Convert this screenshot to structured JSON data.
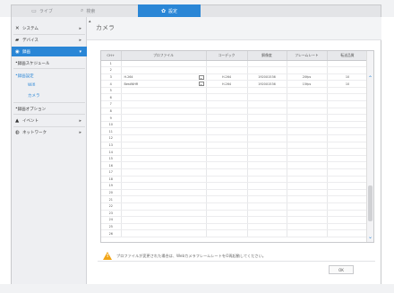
{
  "tabs": [
    {
      "label": "ライブ",
      "icon": "monitor-icon"
    },
    {
      "label": "検索",
      "icon": "search-icon"
    },
    {
      "label": "設定",
      "icon": "gear-icon"
    }
  ],
  "sidebar": {
    "items": [
      {
        "label": "システム",
        "icon": "tools-icon"
      },
      {
        "label": "デバイス",
        "icon": "camera-icon"
      },
      {
        "label": "録画",
        "icon": "record-icon"
      },
      {
        "label": "録画スケジュール"
      },
      {
        "label": "録画設定"
      },
      {
        "label": "Wifi"
      },
      {
        "label": "カメラ"
      },
      {
        "label": "録画オプション"
      },
      {
        "label": "イベント",
        "icon": "event-icon"
      },
      {
        "label": "ネットワーク",
        "icon": "network-icon"
      }
    ]
  },
  "main": {
    "title": "カメラ",
    "table": {
      "headers": [
        "CH+",
        "プロファイル",
        "コーデック",
        "解像度",
        "フレームレート",
        "転送品質"
      ],
      "rows": [
        {
          "ch": "1",
          "profile": "",
          "codec": "",
          "res": "",
          "fps": "",
          "q": ""
        },
        {
          "ch": "2",
          "profile": "",
          "codec": "",
          "res": "",
          "fps": "",
          "q": ""
        },
        {
          "ch": "3",
          "profile": "H.264",
          "codec": "H.264",
          "res": "1920X1536",
          "fps": "20fps",
          "q": "10"
        },
        {
          "ch": "4",
          "profile": "BestWHR",
          "codec": "H.264",
          "res": "1920X1536",
          "fps": "15fps",
          "q": "10"
        },
        {
          "ch": "5",
          "profile": "",
          "codec": "",
          "res": "",
          "fps": "",
          "q": ""
        },
        {
          "ch": "6",
          "profile": "",
          "codec": "",
          "res": "",
          "fps": "",
          "q": ""
        },
        {
          "ch": "7",
          "profile": "",
          "codec": "",
          "res": "",
          "fps": "",
          "q": ""
        },
        {
          "ch": "8",
          "profile": "",
          "codec": "",
          "res": "",
          "fps": "",
          "q": ""
        },
        {
          "ch": "9",
          "profile": "",
          "codec": "",
          "res": "",
          "fps": "",
          "q": ""
        },
        {
          "ch": "10",
          "profile": "",
          "codec": "",
          "res": "",
          "fps": "",
          "q": ""
        },
        {
          "ch": "11",
          "profile": "",
          "codec": "",
          "res": "",
          "fps": "",
          "q": ""
        },
        {
          "ch": "12",
          "profile": "",
          "codec": "",
          "res": "",
          "fps": "",
          "q": ""
        },
        {
          "ch": "13",
          "profile": "",
          "codec": "",
          "res": "",
          "fps": "",
          "q": ""
        },
        {
          "ch": "14",
          "profile": "",
          "codec": "",
          "res": "",
          "fps": "",
          "q": ""
        },
        {
          "ch": "15",
          "profile": "",
          "codec": "",
          "res": "",
          "fps": "",
          "q": ""
        },
        {
          "ch": "16",
          "profile": "",
          "codec": "",
          "res": "",
          "fps": "",
          "q": ""
        },
        {
          "ch": "17",
          "profile": "",
          "codec": "",
          "res": "",
          "fps": "",
          "q": ""
        },
        {
          "ch": "18",
          "profile": "",
          "codec": "",
          "res": "",
          "fps": "",
          "q": ""
        },
        {
          "ch": "19",
          "profile": "",
          "codec": "",
          "res": "",
          "fps": "",
          "q": ""
        },
        {
          "ch": "20",
          "profile": "",
          "codec": "",
          "res": "",
          "fps": "",
          "q": ""
        },
        {
          "ch": "21",
          "profile": "",
          "codec": "",
          "res": "",
          "fps": "",
          "q": ""
        },
        {
          "ch": "22",
          "profile": "",
          "codec": "",
          "res": "",
          "fps": "",
          "q": ""
        },
        {
          "ch": "23",
          "profile": "",
          "codec": "",
          "res": "",
          "fps": "",
          "q": ""
        },
        {
          "ch": "24",
          "profile": "",
          "codec": "",
          "res": "",
          "fps": "",
          "q": ""
        },
        {
          "ch": "25",
          "profile": "",
          "codec": "",
          "res": "",
          "fps": "",
          "q": ""
        },
        {
          "ch": "26",
          "profile": "",
          "codec": "",
          "res": "",
          "fps": "",
          "q": ""
        }
      ]
    },
    "warning": "プロファイルが変更された場合は、WebカメラフレームレートをO再起動してください。",
    "ok_label": "OK"
  },
  "colors": {
    "accent": "#2a86d6",
    "warning": "#f2a516"
  }
}
